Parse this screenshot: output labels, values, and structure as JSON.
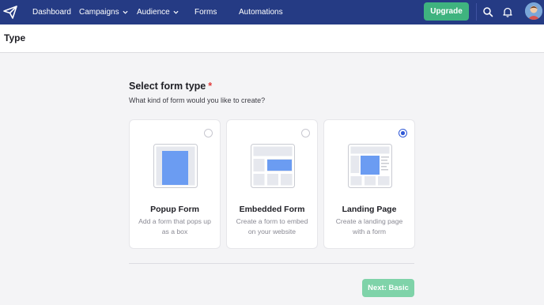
{
  "nav": {
    "items": [
      {
        "label": "Dashboard",
        "has_dropdown": false
      },
      {
        "label": "Campaigns",
        "has_dropdown": true
      },
      {
        "label": "Audience",
        "has_dropdown": true
      },
      {
        "label": "Forms",
        "has_dropdown": false
      },
      {
        "label": "Automations",
        "has_dropdown": false
      }
    ],
    "upgrade_label": "Upgrade",
    "icons": [
      "paper-plane-logo-icon",
      "search-icon",
      "bell-icon",
      "avatar"
    ]
  },
  "page": {
    "title": "Type"
  },
  "section": {
    "title": "Select form type",
    "required_mark": "*",
    "subtitle": "What kind of form would you like to create?"
  },
  "cards": [
    {
      "title": "Popup Form",
      "description": "Add a form that pops up as a box",
      "selected": false,
      "illustration": "popup-form-icon"
    },
    {
      "title": "Embedded Form",
      "description": "Create a form to embed on your website",
      "selected": false,
      "illustration": "embedded-form-icon"
    },
    {
      "title": "Landing Page",
      "description": "Create a landing page with a form",
      "selected": true,
      "illustration": "landing-page-icon"
    }
  ],
  "footer": {
    "next_label": "Next: Basic"
  },
  "colors": {
    "navbar": "#253b84",
    "upgrade": "#3fb37f",
    "next_button": "#7fd3a9",
    "radio_selected": "#2f58d6",
    "illustration_accent": "#6b9cf2",
    "required": "#e03b3b"
  }
}
